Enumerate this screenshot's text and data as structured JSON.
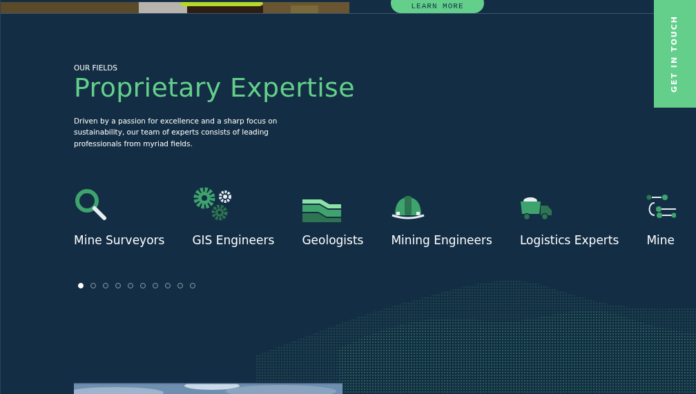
{
  "top_banner": {
    "button": "LEARN MORE"
  },
  "side_tab": {
    "label": "GET IN TOUCH"
  },
  "section": {
    "eyebrow": "OUR FIELDS",
    "title": "Proprietary Expertise",
    "description": "Driven by a passion for excellence and a sharp focus on sustainability, our team of experts consists of leading professionals from myriad fields."
  },
  "fields": [
    {
      "kind": "magnifier",
      "label": "Mine Surveyors"
    },
    {
      "kind": "gears",
      "label": "GIS Engineers"
    },
    {
      "kind": "strata",
      "label": "Geologists"
    },
    {
      "kind": "helmet",
      "label": "Mining Engineers"
    },
    {
      "kind": "truck",
      "label": "Logistics Experts"
    },
    {
      "kind": "flow",
      "label": "Mine"
    }
  ],
  "pager": [
    {
      "selected": true
    },
    {
      "selected": false
    },
    {
      "selected": false
    },
    {
      "selected": false
    },
    {
      "selected": false
    },
    {
      "selected": false
    },
    {
      "selected": false
    },
    {
      "selected": false
    },
    {
      "selected": false
    },
    {
      "selected": false
    }
  ]
}
